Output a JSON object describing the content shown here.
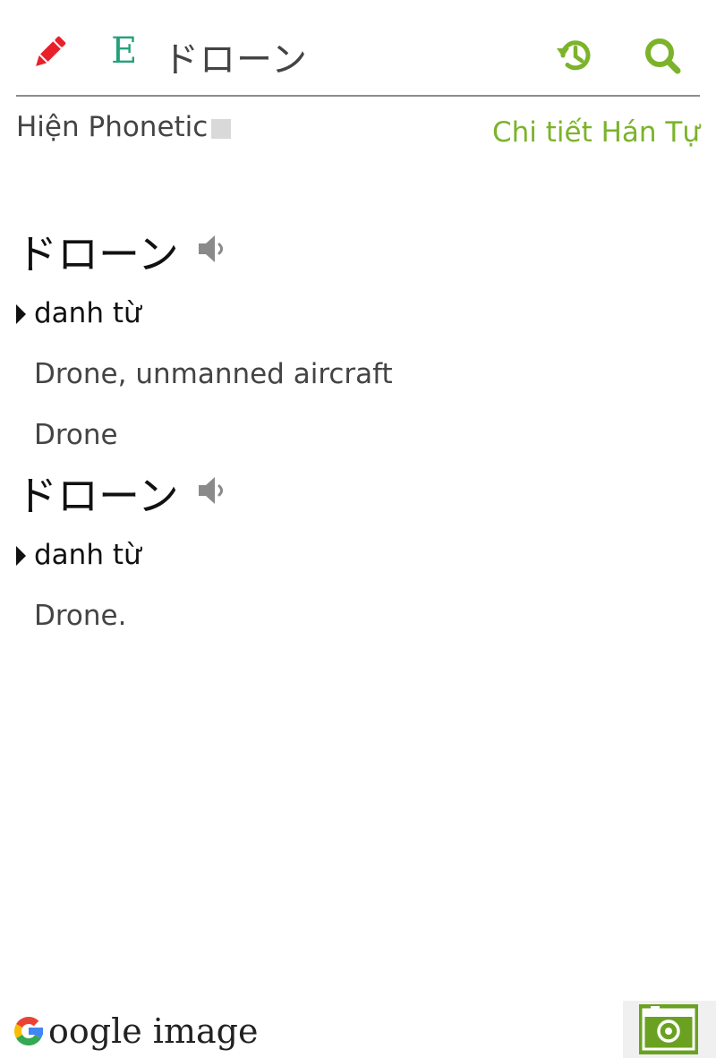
{
  "header": {
    "edit_icon": "pencil-icon",
    "language_badge": "E",
    "search_term": "ドローン",
    "history_icon": "history-icon",
    "search_icon": "search-icon"
  },
  "options": {
    "phonetic_label": "Hiện Phonetic",
    "kanji_detail_link": "Chi tiết Hán Tự"
  },
  "entries": [
    {
      "word": "ドローン",
      "part_of_speech": "danh từ",
      "meanings": [
        "Drone, unmanned aircraft",
        "Drone"
      ]
    },
    {
      "word": "ドローン",
      "part_of_speech": "danh từ",
      "meanings": [
        "Drone."
      ]
    }
  ],
  "footer": {
    "google_image_label": "oogle image",
    "camera_icon": "camera-icon"
  },
  "colors": {
    "accent_green": "#7cb32b",
    "pencil_red": "#e8202a",
    "badge_teal": "#26a17b",
    "camera_green": "#6aa121"
  }
}
